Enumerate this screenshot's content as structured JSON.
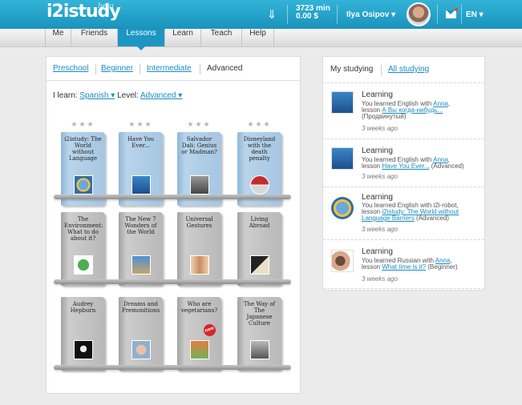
{
  "header": {
    "logo": "i2istudy",
    "beta": "beta",
    "minutes": "3723 min",
    "money": "0.00 $",
    "user": "Ilya Osipov ▾",
    "lang": "EN ▾"
  },
  "nav": [
    "Me",
    "Friends",
    "Lessons",
    "Learn",
    "Teach",
    "Help"
  ],
  "levels": [
    "Preschool",
    "Beginner",
    "Intermediate",
    "Advanced"
  ],
  "filter": {
    "learn_label": "I learn:",
    "language": "Spanish ▾",
    "level_label": "Level:",
    "level": "Advanced ▾"
  },
  "stars": "★★★",
  "new_badge": "new",
  "books": [
    "i2istudy: The World without Language",
    "Have You Ever...",
    "Salvador Dali: Genius or Madman?",
    "Disneyland with the death penalty",
    "The Environment: What to do about it?",
    "The New 7 Wonders of the World",
    "Universal Gestures",
    "Living Abroad",
    "Audrey Hepburn",
    "Dreams and Premonitions",
    "Who are vegetarians?",
    "The Way of The Japanese Culture"
  ],
  "feed_tabs": [
    "My studying",
    "All studying"
  ],
  "feed": [
    {
      "head": "Learning",
      "t1": "You learned English with ",
      "l1": "Anna",
      "t2": ",",
      "t3": "lesson ",
      "l2": "А Вы когда-нибудь...",
      "t4": "(Продвинутый)",
      "time": "3 weeks ago"
    },
    {
      "head": "Learning",
      "t1": "You learned English with ",
      "l1": "Anna",
      "t2": ",",
      "t3": "lesson ",
      "l2": "Have You Ever...",
      "t4": " (Advanced)",
      "time": "3 weeks ago"
    },
    {
      "head": "Learning",
      "t1": "You learned English with i2i-robot,",
      "l1": "",
      "t2": "",
      "t3": "lesson ",
      "l2": "i2istudy: The World without Language Barriers",
      "t4": " (Advanced)",
      "time": "3 weeks ago"
    },
    {
      "head": "Learning",
      "t1": "You learned Russian with ",
      "l1": "Anna",
      "t2": ",",
      "t3": "lesson ",
      "l2": "What time is it?",
      "t4": " (Beginner)",
      "time": "3 weeks ago"
    }
  ]
}
